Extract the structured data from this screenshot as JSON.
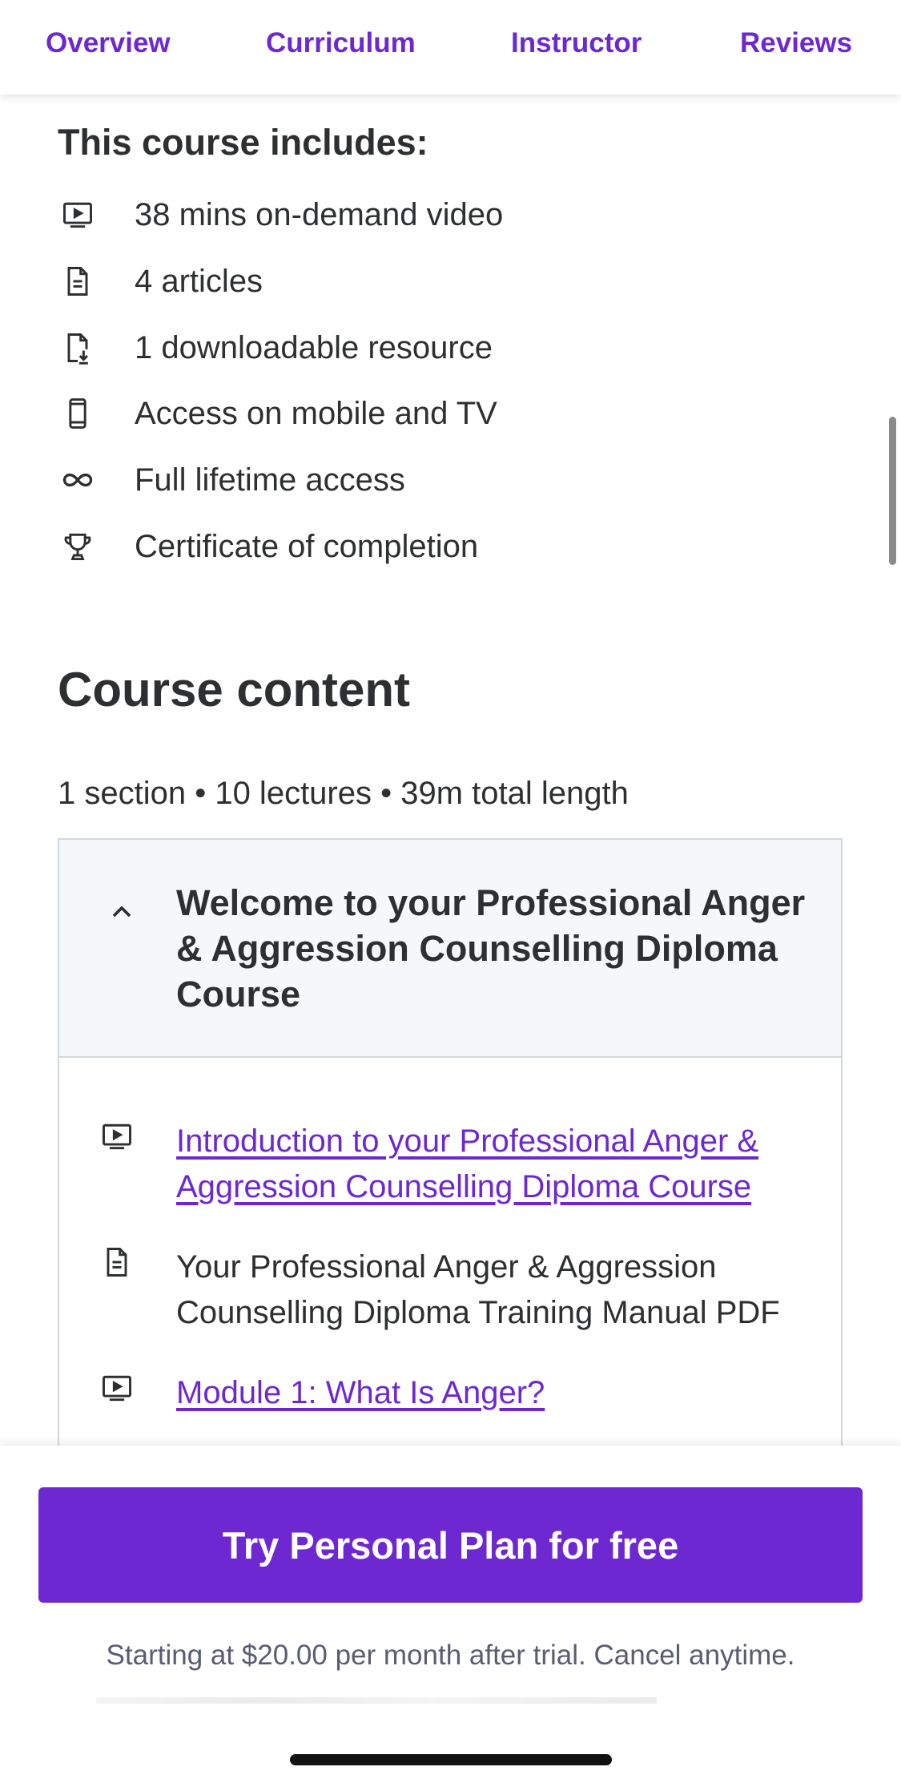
{
  "tabs": [
    "Overview",
    "Curriculum",
    "Instructor",
    "Reviews"
  ],
  "includes": {
    "title": "This course includes:",
    "items": [
      {
        "icon": "video-icon",
        "text": "38 mins on-demand video"
      },
      {
        "icon": "article-icon",
        "text": "4 articles"
      },
      {
        "icon": "download-file-icon",
        "text": "1 downloadable resource"
      },
      {
        "icon": "mobile-icon",
        "text": "Access on mobile and TV"
      },
      {
        "icon": "infinity-icon",
        "text": "Full lifetime access"
      },
      {
        "icon": "trophy-icon",
        "text": "Certificate of completion"
      }
    ]
  },
  "course_content": {
    "title": "Course content",
    "meta": "1 section • 10 lectures • 39m total length",
    "section": {
      "title": "Welcome to your Professional Anger & Aggression Counselling Diploma Course",
      "lectures": [
        {
          "icon": "video-icon",
          "title": "Introduction to your Professional Anger & Aggression Counselling Diploma Course",
          "link": true
        },
        {
          "icon": "article-icon",
          "title": "Your Professional Anger & Aggression Counselling Diploma Training Manual PDF",
          "link": false
        },
        {
          "icon": "video-icon",
          "title": "Module 1: What Is Anger?",
          "link": true
        }
      ]
    }
  },
  "cta": {
    "button": "Try Personal Plan for free",
    "subtext": "Starting at $20.00 per month after trial. Cancel anytime."
  },
  "colors": {
    "accent": "#6d28d2",
    "text": "#2d2f31",
    "panel_bg": "#f6f7f9"
  }
}
